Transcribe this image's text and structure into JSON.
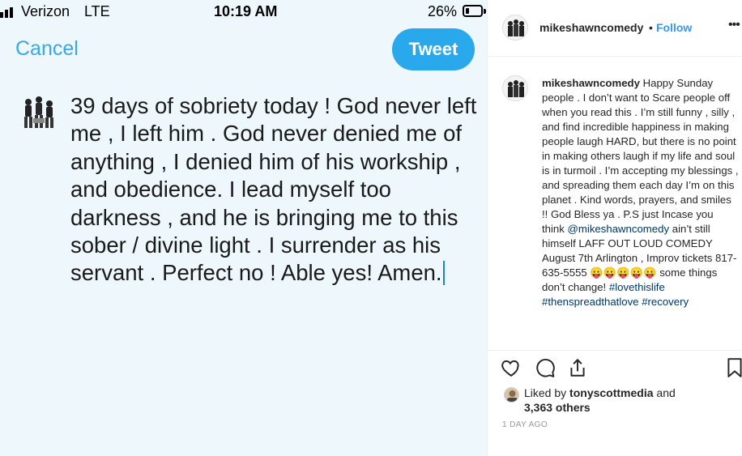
{
  "phone": {
    "status": {
      "carrier": "Verizon",
      "network": "LTE",
      "time": "10:19 AM",
      "battery_percent": "26%",
      "battery_level": 0.26
    },
    "cancel_label": "Cancel",
    "tweet_label": "Tweet",
    "tweet_text": "39 days of sobriety today ! God never left me , I left him . God never denied me of anything , I denied him of his workship , and obedience. I lead myself too darkness , and he is bringing me to this sober / divine light . I surrender as his servant . Perfect no ! Able yes! Amen."
  },
  "instagram": {
    "username": "mikeshawncomedy",
    "separator": "•",
    "follow_label": "Follow",
    "more_icon": "more-horizontal-icon",
    "caption": {
      "username": "mikeshawncomedy",
      "text_1": "Happy Sunday people . I don’t want to Scare people off when you read this . I’m still funny , silly , and find incredible happiness in making people laugh HARD, but there is no point in making others laugh if my life and soul is in turmoil . I’m accepting my blessings , and spreading them each day I’m on this planet . Kind words, prayers, and smiles !! God Bless ya . P.S just Incase you think",
      "mention": "@mikeshawncomedy",
      "text_2": "ain’t still himself LAFF OUT LOUD COMEDY August 7th Arlington , Improv tickets 817-635-5555",
      "emoji": "😛😛😛😛😛",
      "text_3": "some things don’t change!",
      "hashtag_1": "#lovethislife",
      "hashtag_2": "#thenspreadthatlove",
      "hashtag_3": "#recovery"
    },
    "actions": [
      "heart-icon",
      "comment-icon",
      "share-icon",
      "bookmark-icon"
    ],
    "likes": {
      "prefix": "Liked by",
      "user": "tonyscottmedia",
      "and": "and",
      "others": "3,363 others"
    },
    "timestamp": "1 DAY AGO"
  }
}
